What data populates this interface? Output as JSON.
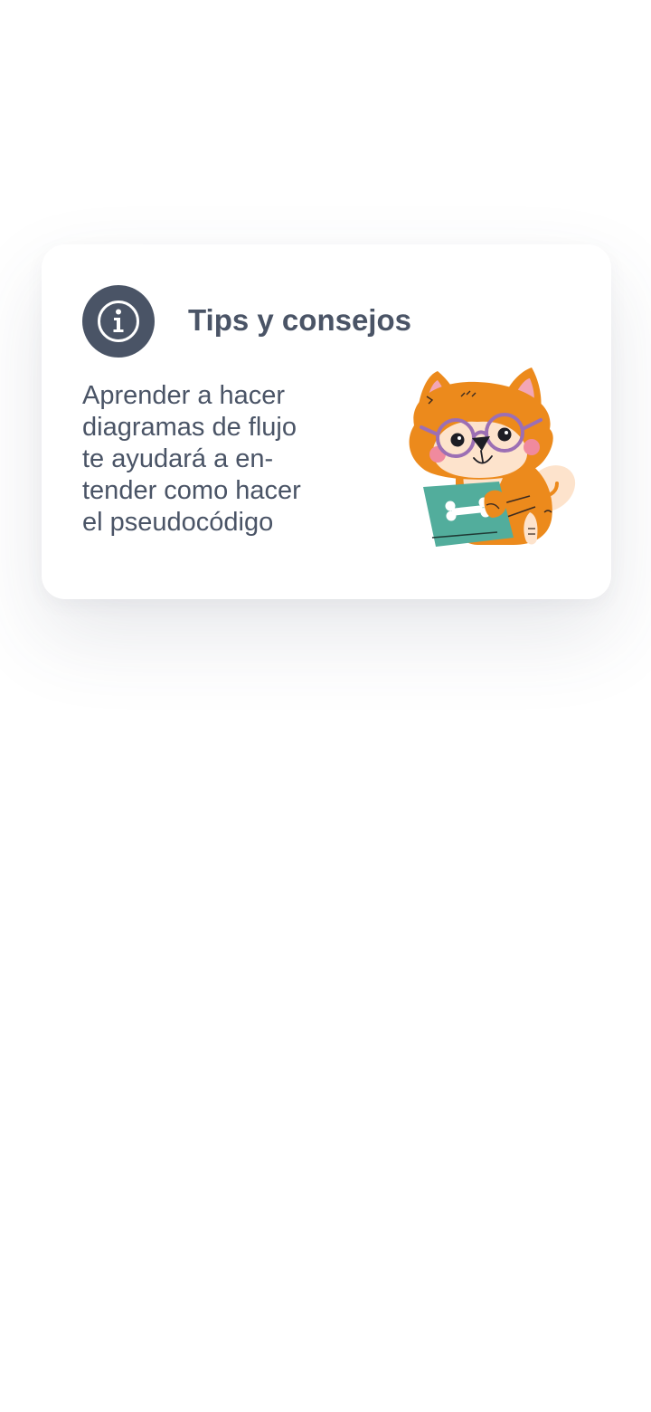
{
  "tip_card": {
    "icon": "info-icon",
    "title": "Tips y consejos",
    "body_lines": [
      "Aprender a hacer",
      "diagramas de flujo",
      "te ayudará a en-",
      "tender como hacer",
      "el pseudocódigo"
    ],
    "illustration": "dog-with-glasses-and-laptop-illustration"
  },
  "colors": {
    "background": "#ffffff",
    "card": "#ffffff",
    "text": "#4a5466",
    "icon_badge": "#4a5466",
    "dog_orange": "#ec8a1c",
    "dog_cream": "#fde3cc",
    "laptop_teal": "#52ad9c",
    "glasses_purple": "#9c6fb4",
    "cheek_pink": "#f08a9e"
  }
}
